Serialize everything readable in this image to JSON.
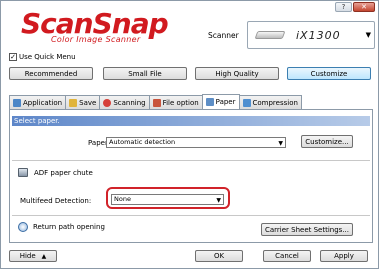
{
  "window": {
    "help_glyph": "?",
    "close_glyph": "✕"
  },
  "logo": {
    "title": "ScanSnap",
    "subtitle": "Color Image Scanner"
  },
  "scanner": {
    "label": "Scanner",
    "selected": "iX1300"
  },
  "quick_menu": {
    "label": "Use Quick Menu",
    "checked": true
  },
  "modes": [
    {
      "label": "Recommended"
    },
    {
      "label": "Small File"
    },
    {
      "label": "High Quality"
    },
    {
      "label": "Customize",
      "active": true
    }
  ],
  "tabs": [
    {
      "label": "Application",
      "icon": "application-icon",
      "color": "#4b86c7"
    },
    {
      "label": "Save",
      "icon": "folder-icon",
      "color": "#e0b43c"
    },
    {
      "label": "Scanning",
      "icon": "scanning-icon",
      "color": "#d6403a"
    },
    {
      "label": "File option",
      "icon": "file-option-icon",
      "color": "#c8553d"
    },
    {
      "label": "Paper",
      "icon": "paper-icon",
      "color": "#5d8ec6",
      "active": true
    },
    {
      "label": "Compression",
      "icon": "compression-icon",
      "color": "#4f8fd0"
    }
  ],
  "paper": {
    "section_title": "Select paper.",
    "paper_size_label": "Paper size:",
    "paper_size_value": "Automatic detection",
    "customize_button": "Customize...",
    "adf_label": "ADF paper chute",
    "multifeed_label": "Multifeed Detection:",
    "multifeed_value": "None",
    "return_path_label": "Return path opening",
    "carrier_button": "Carrier Sheet Settings..."
  },
  "footer": {
    "hide": "Hide",
    "hide_glyph": "▲",
    "ok": "OK",
    "cancel": "Cancel",
    "apply": "Apply"
  },
  "colors": {
    "brand": "#d11a1f",
    "section_header": "#5e87c9",
    "highlight": "#d1232a"
  }
}
